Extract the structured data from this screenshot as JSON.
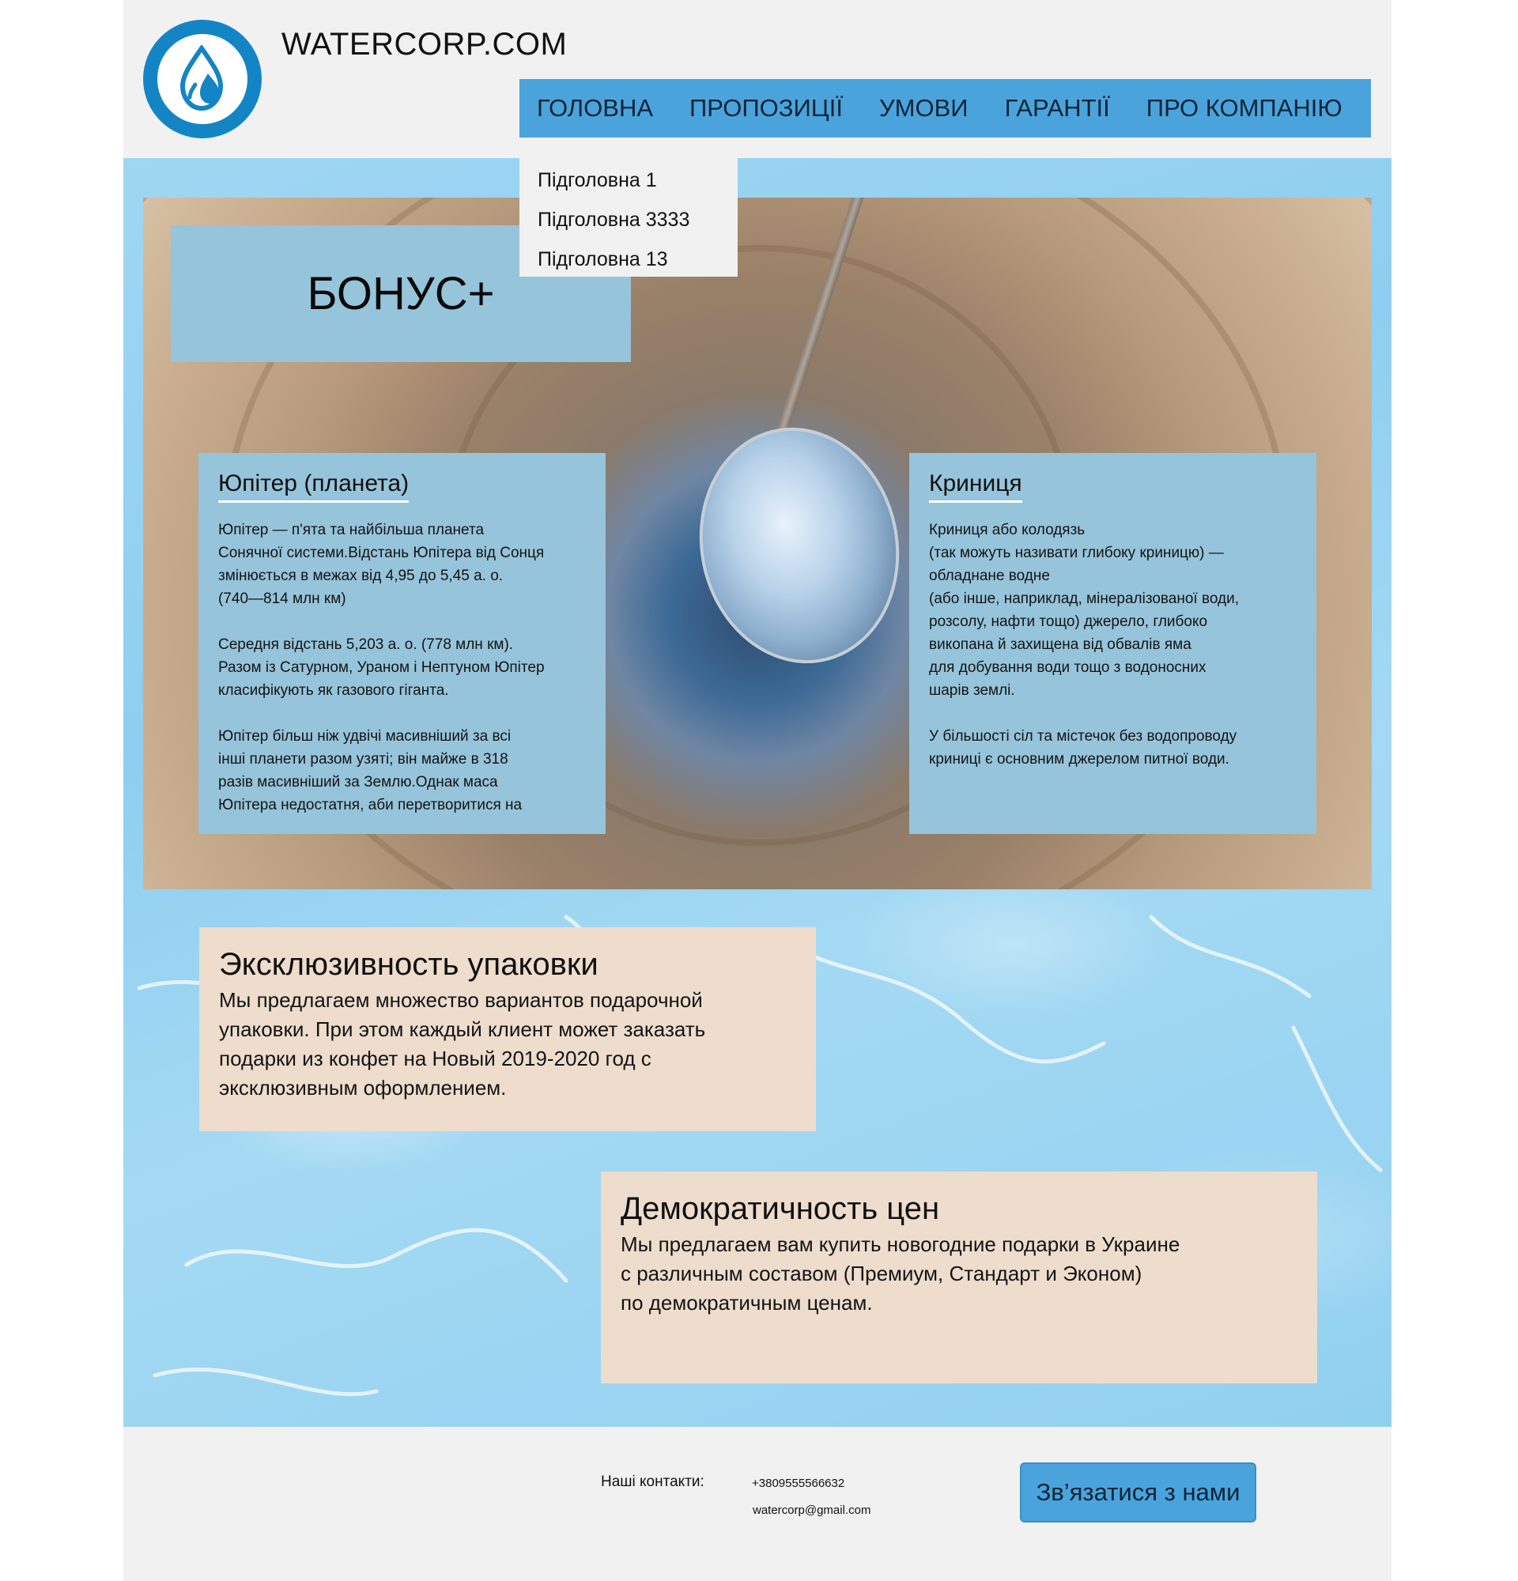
{
  "header": {
    "site_title": "WATERCORP.COM",
    "logo_icon": "water-drops-icon",
    "brand_color": "#1485c4"
  },
  "nav": {
    "items": [
      "ГОЛОВНА",
      "ПРОПОЗИЦІЇ",
      "УМОВИ",
      "ГАРАНТІЇ",
      "ПРО КОМПАНІЮ"
    ],
    "background": "#4ba3dc"
  },
  "dropdown": {
    "items": [
      "Підголовна 1",
      "Підголовна 3333",
      "Підголовна 13"
    ]
  },
  "hero": {
    "title": "БОНУС+",
    "cards": [
      {
        "title": "Юпітер (планета)",
        "paragraphs": [
          "Юпітер — п'ята та найбільша планета\nСонячної системи.Відстань Юпітера від Сонця\n змінюється в межах від 4,95 до 5,45 а. о.\n (740—814 млн км)",
          "Середня відстань 5,203 а. о. (778 млн км).\nРазом із Сатурном, Ураном і Нептуном Юпітер\nкласифікують як газового гіганта.",
          "Юпітер більш ніж удвічі масивніший за всі\nінші планети разом узяті; він майже в 318\nразів масивніший за Землю.Однак маса\nЮпітера недостатня, аби перетворитися на"
        ]
      },
      {
        "title": "Криниця",
        "paragraphs": [
          "Криниця або колодязь\n(так можуть називати глибоку криницю) —\nобладнане водне\n(або інше, наприклад, мінералізованої води,\nрозсолу, нафти тощо) джерело, глибоко\nвикопана й захищена від обвалів яма\nдля добування води тощо з водоносних\nшарів землі.",
          "У більшості сіл та містечок без водопроводу\nкриниці є основним джерелом питної води."
        ]
      }
    ]
  },
  "features": [
    {
      "title": "Эксклюзивность упаковки",
      "text": "Мы предлагаем множество вариантов подарочной\nупаковки. При этом каждый клиент может заказать\nподарки из конфет на Новый 2019-2020 год с\nэксклюзивным оформлением."
    },
    {
      "title": "Демократичность цен",
      "text": "Мы предлагаем вам купить новогодние подарки в Украине\nс различным составом (Премиум, Стандарт и Эконом)\nпо демократичным ценам."
    }
  ],
  "footer": {
    "contacts_label": "Наші контакти:",
    "phone": "+3809555566632",
    "email": "watercorp@gmail.com",
    "contact_button": "Зв’язатися з нами"
  }
}
